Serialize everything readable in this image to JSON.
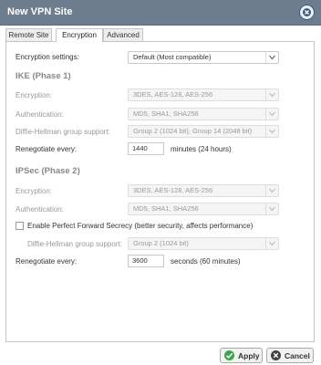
{
  "window": {
    "title": "New VPN Site"
  },
  "tabs": [
    {
      "label": "Remote Site"
    },
    {
      "label": "Encryption"
    },
    {
      "label": "Advanced"
    }
  ],
  "encryption_settings": {
    "label": "Encryption settings:",
    "value": "Default (Most compatible)"
  },
  "ike": {
    "heading": "IKE (Phase 1)",
    "encryption": {
      "label": "Encryption:",
      "value": "3DES, AES-128, AES-256"
    },
    "authentication": {
      "label": "Authentication:",
      "value": "MD5, SHA1, SHA256"
    },
    "dh_group": {
      "label": "Diffie-Hellman group support:",
      "value": "Group 2 (1024 bit), Group 14 (2048 bit)"
    },
    "renegotiate": {
      "label": "Renegotiate every:",
      "value": "1440",
      "unit": "minutes (24 hours)"
    }
  },
  "ipsec": {
    "heading": "IPSec (Phase 2)",
    "encryption": {
      "label": "Encryption:",
      "value": "3DES, AES-128, AES-256"
    },
    "authentication": {
      "label": "Authentication:",
      "value": "MD5, SHA1, SHA256"
    },
    "pfs": {
      "label": "Enable Perfect Forward Secrecy (better security, affects performance)",
      "checked": false
    },
    "dh_group": {
      "label": "Diffie-Hellman group support:",
      "value": "Group 2 (1024 bit)"
    },
    "renegotiate": {
      "label": "Renegotiate every:",
      "value": "3600",
      "unit": "seconds (60 minutes)"
    }
  },
  "footer": {
    "apply_label": "Apply",
    "cancel_label": "Cancel"
  },
  "colors": {
    "titlebar": "#6e7d8d",
    "apply_icon": "#3aa64a",
    "cancel_icon": "#444444"
  }
}
